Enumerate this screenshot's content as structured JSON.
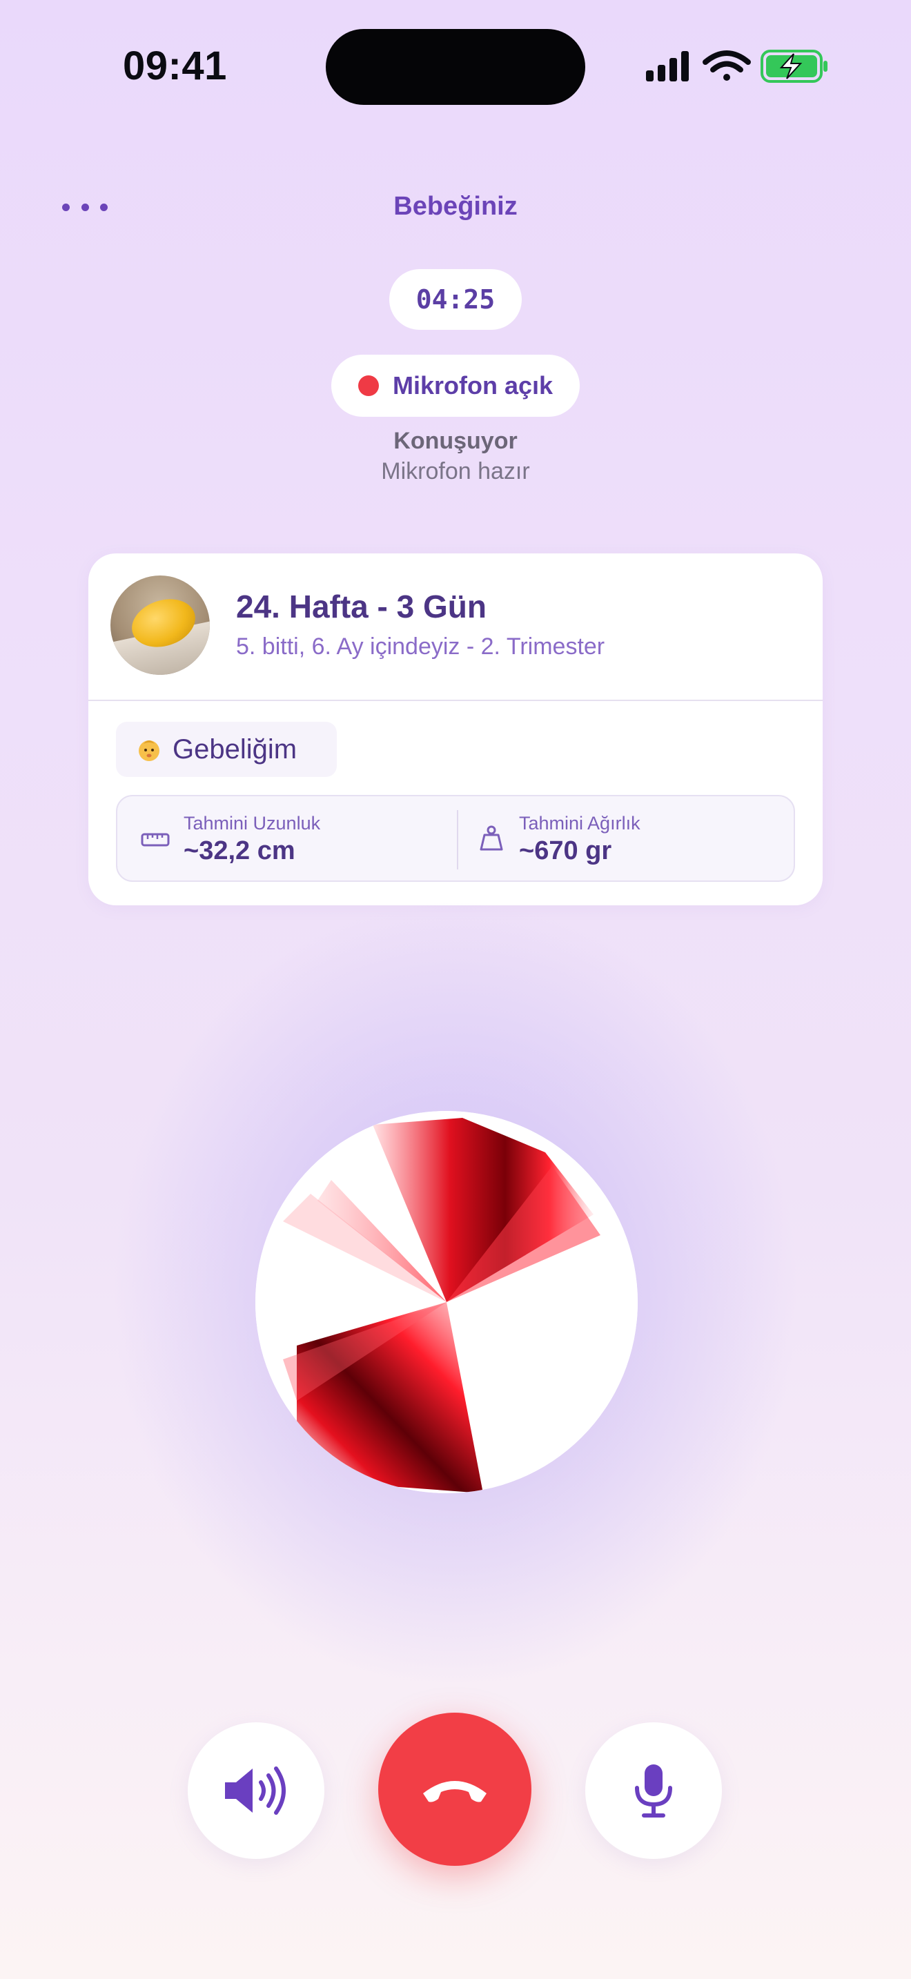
{
  "status_bar": {
    "time": "09:41"
  },
  "header": {
    "menu_icon": "more-horizontal-icon",
    "title": "Bebeğiniz"
  },
  "call": {
    "timer": "04:25",
    "mic_status": "Mikrofon açık",
    "speaking_label": "Konuşuyor",
    "mic_ready_label": "Mikrofon hazır"
  },
  "pregnancy_card": {
    "week_title": "24. Hafta - 3 Gün",
    "subtitle": "5. bitti, 6. Ay içindeyiz - 2. Trimester",
    "tag_label": "Gebeliğim",
    "metrics": [
      {
        "label": "Tahmini Uzunluk",
        "value": "~32,2 cm",
        "icon": "ruler-icon"
      },
      {
        "label": "Tahmini Ağırlık",
        "value": "~670 gr",
        "icon": "weight-icon"
      }
    ]
  },
  "controls": {
    "speaker_icon": "speaker-icon",
    "end_call_icon": "phone-hangup-icon",
    "mic_icon": "microphone-icon"
  },
  "colors": {
    "accent": "#6b44b8",
    "end_call": "#f23e46",
    "mic_dot": "#ef3a45",
    "battery": "#34c759"
  }
}
